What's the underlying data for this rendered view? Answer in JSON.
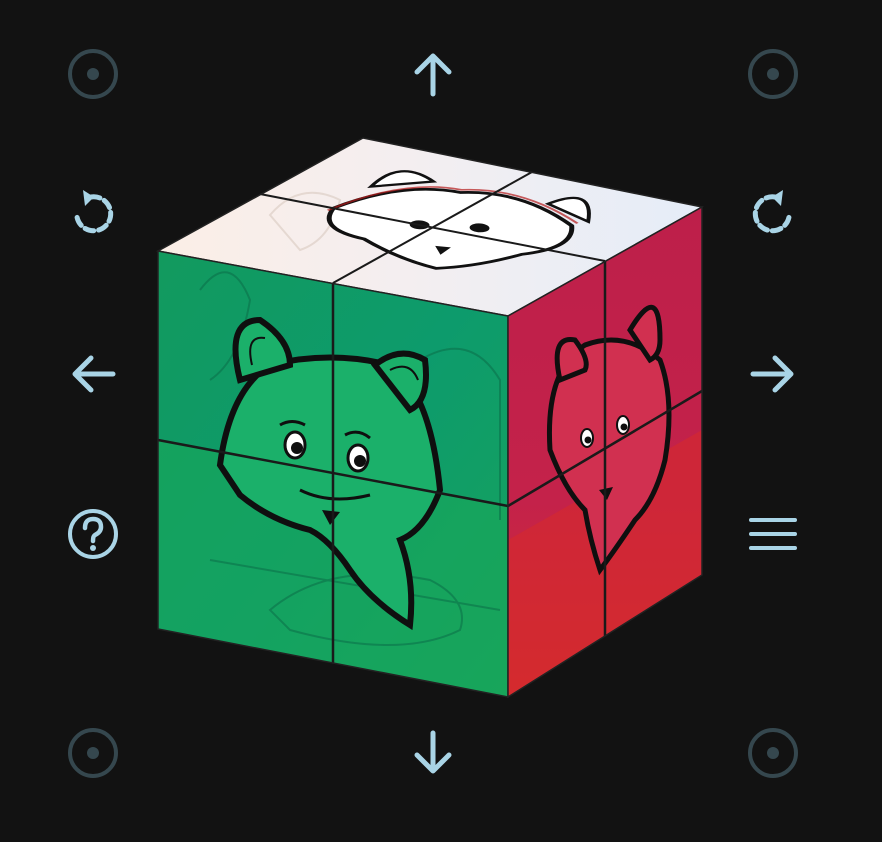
{
  "theme": {
    "background": "#121212",
    "icon_color": "#a9d4e6",
    "icon_dim_color": "#35474e",
    "top_face_color": "#e8eef8",
    "top_face_warm_color": "#fbeee6",
    "front_face_color": "#17a866",
    "front_face_deep_color": "#0a9a6e",
    "right_face_color": "#c0204a",
    "right_face_lower_color": "#d12a32",
    "sticker_line_color": "#1a1a1a"
  },
  "controls": {
    "corner_top_left": {
      "icon": "dot-ring-icon",
      "state": "inactive"
    },
    "corner_top_right": {
      "icon": "dot-ring-icon",
      "state": "inactive"
    },
    "corner_bottom_left": {
      "icon": "dot-ring-icon",
      "state": "inactive"
    },
    "corner_bottom_right": {
      "icon": "dot-ring-icon",
      "state": "inactive"
    },
    "rotate_up": {
      "icon": "arrow-up-icon"
    },
    "rotate_down": {
      "icon": "arrow-down-icon"
    },
    "rotate_left": {
      "icon": "arrow-left-icon"
    },
    "rotate_right": {
      "icon": "arrow-right-icon"
    },
    "rotate_ccw": {
      "icon": "rotate-ccw-icon"
    },
    "rotate_cw": {
      "icon": "rotate-cw-icon"
    },
    "help": {
      "icon": "help-icon"
    },
    "menu": {
      "icon": "menu-icon"
    }
  },
  "cube": {
    "size": "2x2",
    "faces": {
      "top": {
        "color": "white",
        "picture": "fox"
      },
      "front": {
        "color": "green",
        "picture": "fox"
      },
      "right": {
        "color": "red",
        "picture": "fox"
      }
    }
  }
}
